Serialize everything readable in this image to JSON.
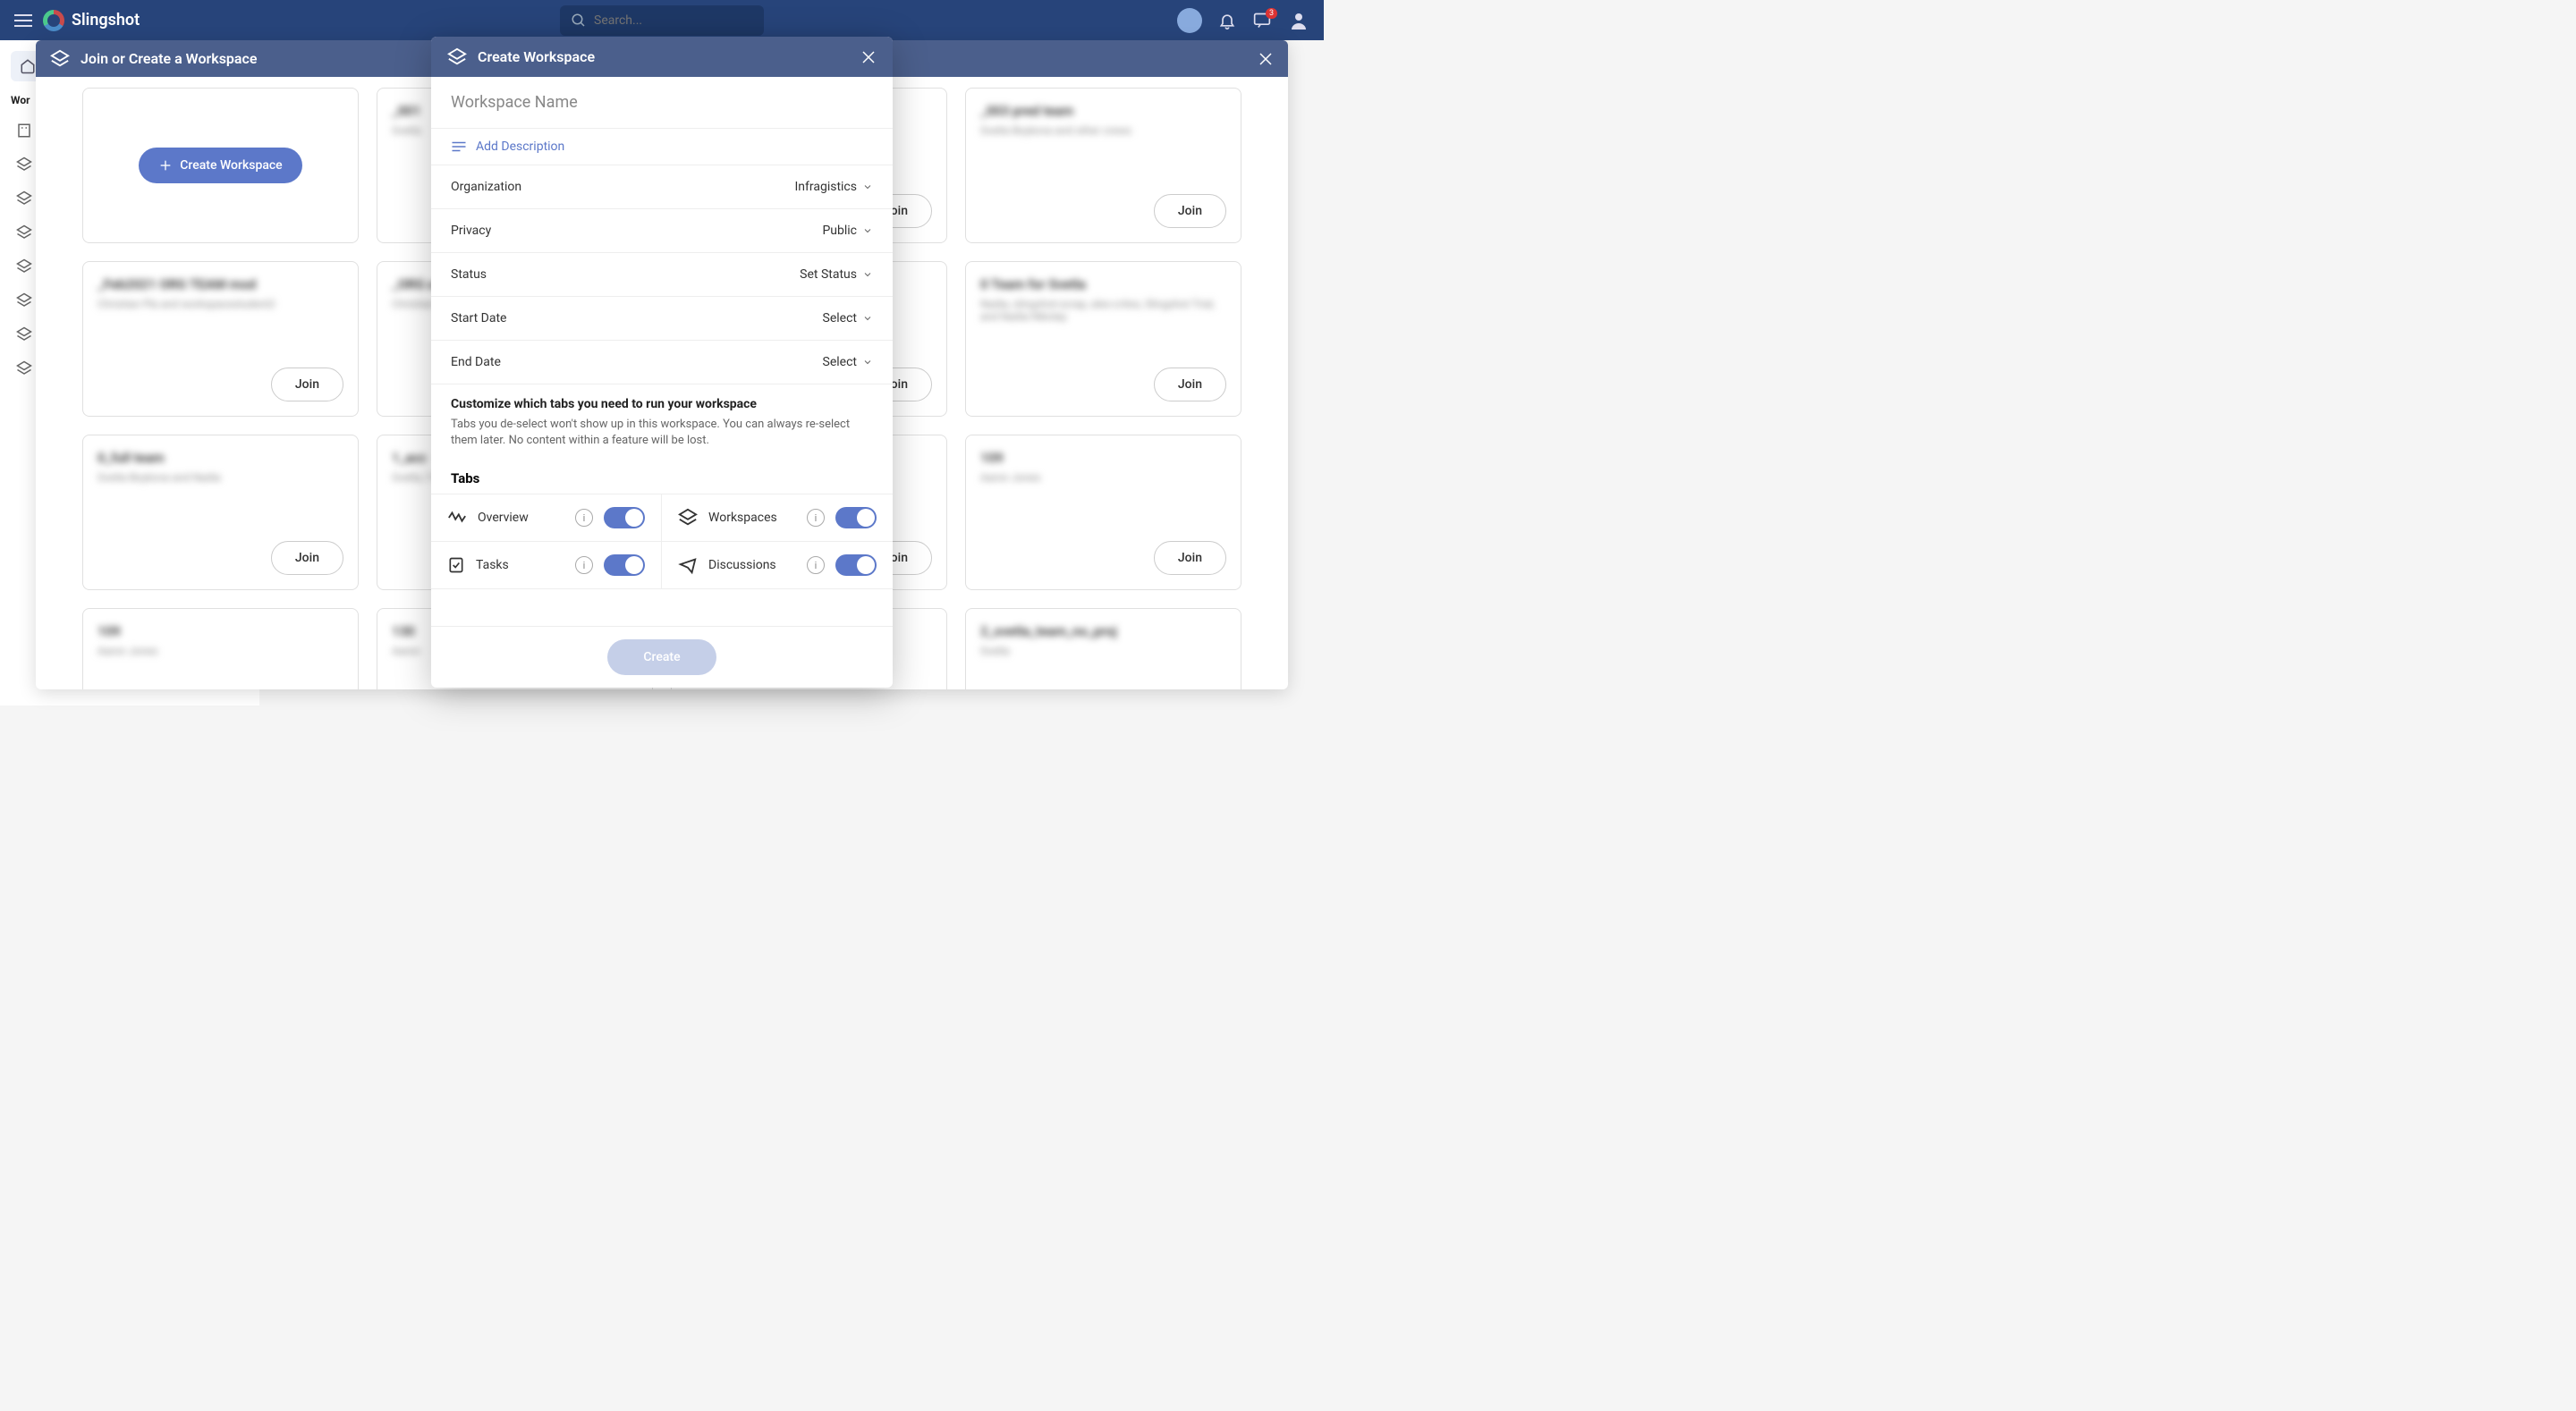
{
  "app": {
    "name": "Slingshot",
    "search_placeholder": "Search...",
    "notif_badge": "3"
  },
  "sidebar": {
    "heading": "Wor"
  },
  "wideModal": {
    "title": "Join or Create a Workspace",
    "create_label": "Create Workspace",
    "join_label": "Join",
    "cards": [
      {
        "title": "_001 ",
        "sub": "Svetla"
      },
      {
        "title": "",
        "sub": ""
      },
      {
        "title": "_003 pred team",
        "sub": "Svetla Boykova and other crews"
      },
      {
        "title": "_Feb2021 ORG TEAM mod",
        "sub": "Christian Pla and workspacestudent2"
      },
      {
        "title": "_ORG a",
        "sub": "Christian"
      },
      {
        "title": "",
        "sub": ""
      },
      {
        "title": "0 Team for Svetla",
        "sub": "Nadia, slingshot-scrap, alex-crites, Slingshot Trial, and Nadia Nikolay"
      },
      {
        "title": "0_full team",
        "sub": "Svetla Boykova and Nadia"
      },
      {
        "title": "1_acc",
        "sub": "Svetla, f Wright"
      },
      {
        "title": "",
        "sub": ""
      },
      {
        "title": "109",
        "sub": "Aaron Jones"
      },
      {
        "title": "109",
        "sub": "Aaron Jones"
      },
      {
        "title": "130",
        "sub": "Aaron"
      },
      {
        "title": "",
        "sub": ""
      },
      {
        "title": "2_svetla_team_no_proj",
        "sub": "Svetla"
      }
    ]
  },
  "innerModal": {
    "title": "Create Workspace",
    "name_placeholder": "Workspace Name",
    "add_desc": "Add Description",
    "rows": {
      "org_label": "Organization",
      "org_value": "Infragistics",
      "privacy_label": "Privacy",
      "privacy_value": "Public",
      "status_label": "Status",
      "status_value": "Set Status",
      "start_label": "Start Date",
      "start_value": "Select",
      "end_label": "End Date",
      "end_value": "Select"
    },
    "customize_title": "Customize which tabs you need to run your workspace",
    "customize_desc": "Tabs you de-select won't show up in this workspace. You can always re-select them later. No content within a feature will be lost.",
    "tabs_heading": "Tabs",
    "tabs": [
      {
        "name": "Overview"
      },
      {
        "name": "Workspaces"
      },
      {
        "name": "Tasks"
      },
      {
        "name": "Discussions"
      }
    ],
    "create_btn": "Create"
  }
}
